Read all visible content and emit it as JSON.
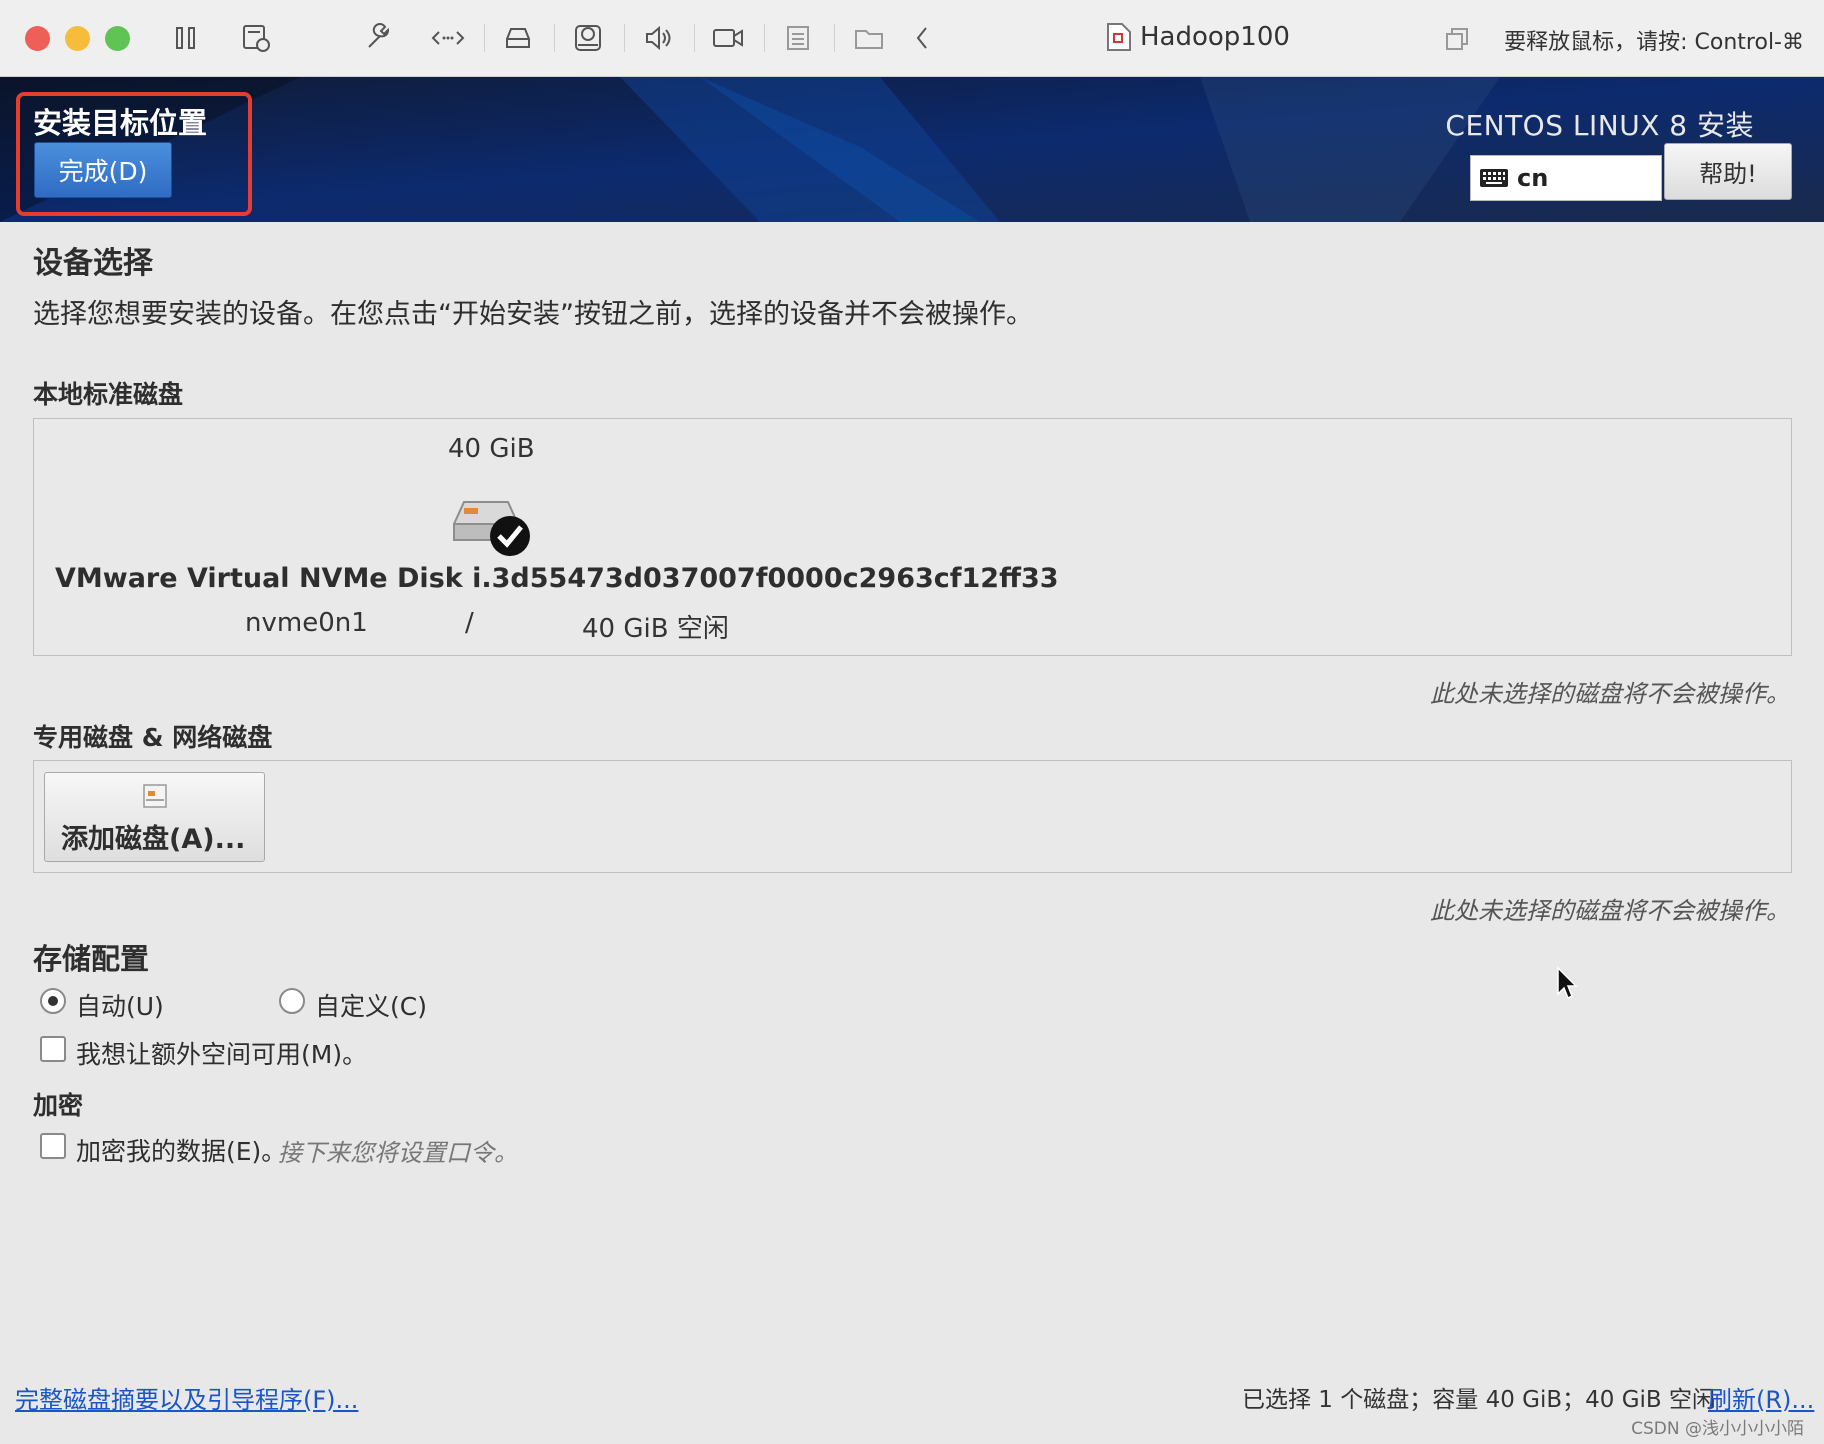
{
  "window": {
    "title": "Hadoop100",
    "release_hint": "要释放鼠标，请按: Control-⌘"
  },
  "header": {
    "title": "安装目标位置",
    "done_button": "完成(D)",
    "product": "CENTOS LINUX 8 安装",
    "keyboard_layout": "cn",
    "help_button": "帮助!"
  },
  "device_selection": {
    "heading": "设备选择",
    "description": "选择您想要安装的设备。在您点击“开始安装”按钮之前，选择的设备并不会被操作。"
  },
  "local_disks": {
    "heading": "本地标准磁盘",
    "disk": {
      "size": "40 GiB",
      "name": "VMware Virtual NVMe Disk i.3d55473d037007f0000c2963cf12ff33",
      "device": "nvme0n1",
      "separator": "/",
      "free": "40 GiB 空闲",
      "selected": true
    },
    "note": "此处未选择的磁盘将不会被操作。"
  },
  "network_disks": {
    "heading": "专用磁盘 & 网络磁盘",
    "add_button": "添加磁盘(A)...",
    "note": "此处未选择的磁盘将不会被操作。"
  },
  "storage_config": {
    "heading": "存储配置",
    "auto_label": "自动(U)",
    "custom_label": "自定义(C)",
    "selected": "auto",
    "extra_space_label": "我想让额外空间可用(M)。",
    "extra_space_checked": false
  },
  "encryption": {
    "heading": "加密",
    "encrypt_label": "加密我的数据(E)。",
    "encrypt_hint": "接下来您将设置口令。",
    "encrypt_checked": false
  },
  "footer": {
    "summary_link": "完整磁盘摘要以及引导程序(F)...",
    "status": "已选择 1 个磁盘；容量 40 GiB；40 GiB 空闲",
    "refresh_link": "刷新(R)...",
    "watermark": "CSDN @浅小小小小陌"
  },
  "colors": {
    "highlight": "#e53e2f",
    "done_button": "#3b7dd3",
    "header_bg": "#0a1633",
    "link": "#1a56c8"
  }
}
